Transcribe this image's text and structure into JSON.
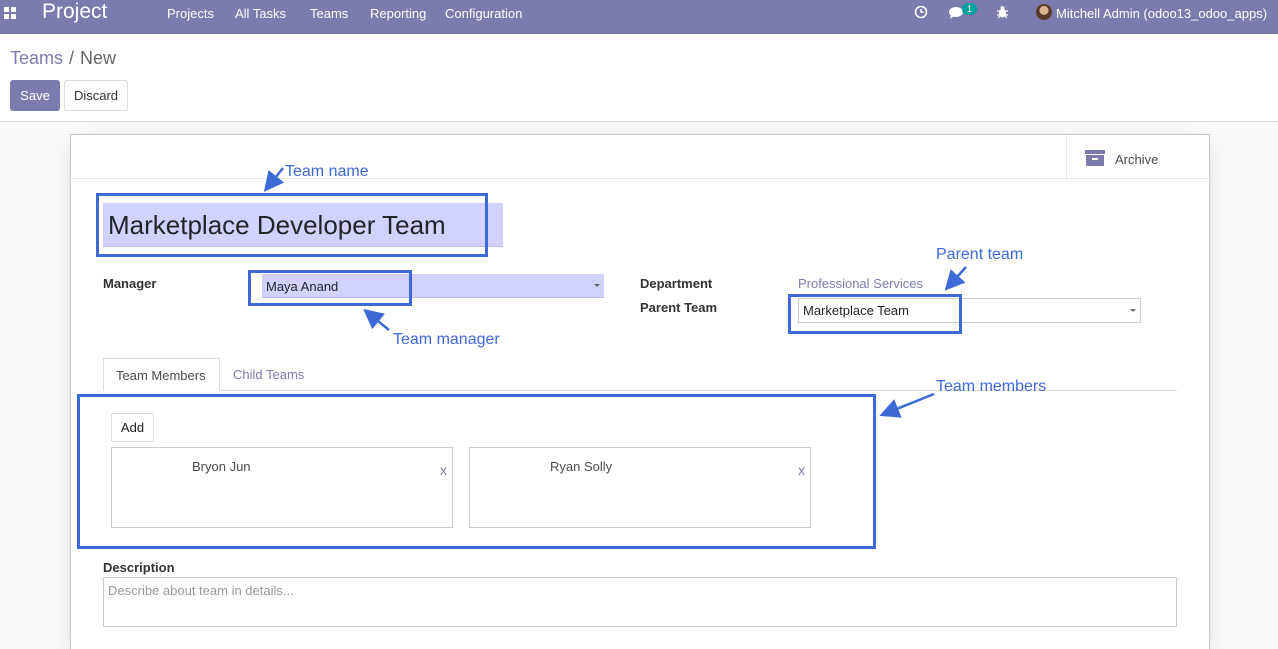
{
  "navbar": {
    "brand": "Project",
    "menu": [
      "Projects",
      "All Tasks",
      "Teams",
      "Reporting",
      "Configuration"
    ],
    "message_count": "1",
    "user": "Mitchell Admin (odoo13_odoo_apps)"
  },
  "breadcrumb": {
    "parent": "Teams",
    "separator": "/",
    "current": "New"
  },
  "actions": {
    "save": "Save",
    "discard": "Discard"
  },
  "archive_label": "Archive",
  "form": {
    "team_name": "Marketplace Developer Team",
    "manager_label": "Manager",
    "manager_value": "Maya Anand",
    "department_label": "Department",
    "department_value": "Professional Services",
    "parent_team_label": "Parent Team",
    "parent_team_value": "Marketplace Team"
  },
  "tabs": {
    "members": "Team Members",
    "child": "Child Teams"
  },
  "members": {
    "add_label": "Add",
    "remove_label": "x",
    "items": [
      "Bryon Jun",
      "Ryan Solly"
    ]
  },
  "description": {
    "label": "Description",
    "placeholder": "Describe about team in details..."
  },
  "annotations": {
    "team_name": "Team name",
    "parent_team": "Parent team",
    "team_manager": "Team manager",
    "team_members": "Team members"
  },
  "colors": {
    "brand": "#7c7bad",
    "annotation": "#3e6ad6",
    "field_highlight": "#d2d2ff"
  },
  "icons": [
    "apps-icon",
    "clock-icon",
    "chat-icon",
    "bug-icon",
    "archive-icon",
    "caret-down-icon"
  ]
}
